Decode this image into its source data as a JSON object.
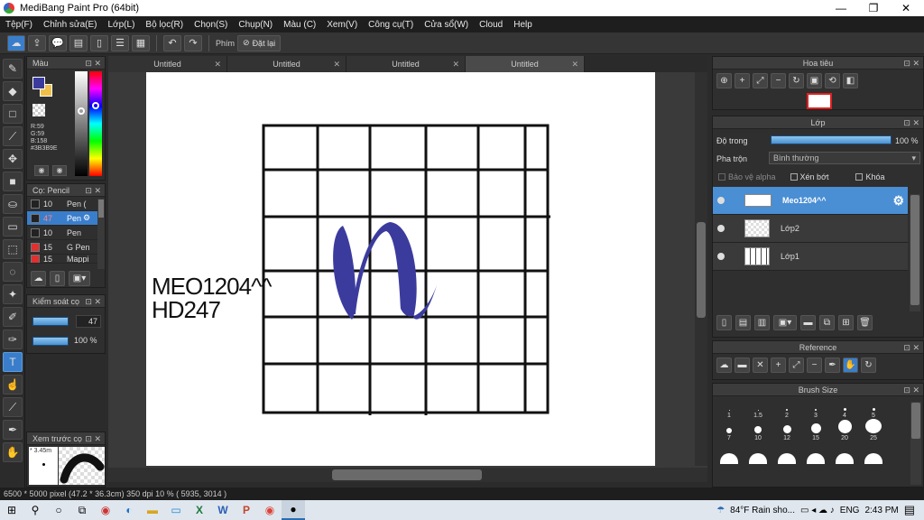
{
  "window": {
    "title": "MediBang Paint Pro (64bit)"
  },
  "menu": [
    "Tệp(F)",
    "Chỉnh sửa(E)",
    "Lớp(L)",
    "Bộ lọc(R)",
    "Chọn(S)",
    "Chụp(N)",
    "Màu (C)",
    "Xem(V)",
    "Công cụ(T)",
    "Cửa sổ(W)",
    "Cloud",
    "Help"
  ],
  "toolbar": {
    "shortcut_label": "Phím",
    "reset_label": "Đặt lại"
  },
  "tabs": [
    "Untitled",
    "Untitled",
    "Untitled",
    "Untitled"
  ],
  "color_panel": {
    "title": "Màu",
    "r": "R:59",
    "g": "G:59",
    "b": "B:158",
    "hex": "#3B3B9E",
    "primary": "#3b3b9e",
    "secondary": "#f0c04a"
  },
  "brush_panel": {
    "title": "Cọ: Pencil",
    "items": [
      {
        "size": "10",
        "name": "Pen (",
        "color": "#222222"
      },
      {
        "size": "47",
        "name": "Pen",
        "color": "#222222"
      },
      {
        "size": "10",
        "name": "Pen",
        "color": "#222222"
      },
      {
        "size": "15",
        "name": "G Pen",
        "color": "#e03030"
      },
      {
        "size": "15",
        "name": "Mappi",
        "color": "#e03030"
      }
    ]
  },
  "control_panel": {
    "title": "Kiểm soát cọ",
    "size": "47",
    "opacity": "100 %"
  },
  "preview_panel": {
    "title": "Xem trước cọ",
    "size_label": "* 3.45m"
  },
  "canvas": {
    "text_line1": "MEO1204^^",
    "text_line2": "HD247",
    "ink_color": "#3b3b9e"
  },
  "status": {
    "text": "6500 * 5000 pixel  (47.2 * 36.3cm)   350 dpi   10 %   ( 5935, 3014 )"
  },
  "navigator": {
    "title": "Hoa tiêu"
  },
  "layer_panel": {
    "title": "Lớp",
    "opacity_label": "Độ trong",
    "opacity_value": "100 %",
    "blend_label": "Pha trộn",
    "blend_value": "Bình thường",
    "protect_alpha": "Bảo vệ alpha",
    "clipping": "Xén bớt",
    "lock": "Khóa",
    "layers": [
      "Meo1204^^",
      "Lớp2",
      "Lớp1"
    ]
  },
  "reference_panel": {
    "title": "Reference"
  },
  "brush_size_panel": {
    "title": "Brush Size",
    "sizes": [
      "1",
      "1.5",
      "2",
      "3",
      "4",
      "5",
      "7",
      "10",
      "12",
      "15",
      "20",
      "25"
    ]
  },
  "taskbar": {
    "weather": "84°F  Rain sho...",
    "lang": "ENG",
    "time": "2:43 PM"
  }
}
